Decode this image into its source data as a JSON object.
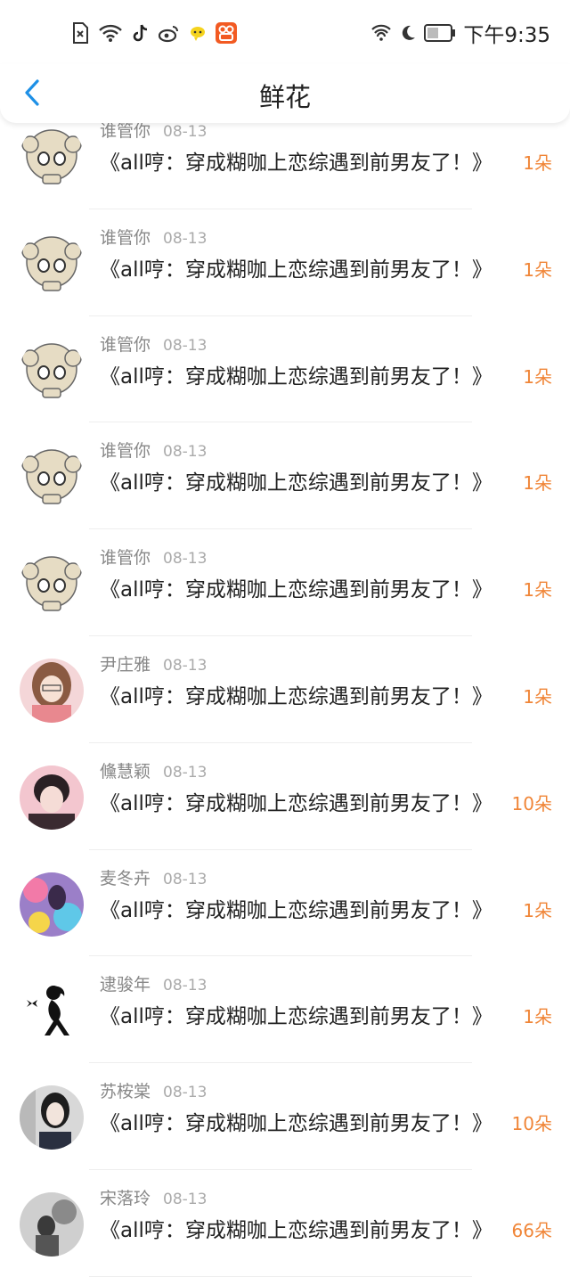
{
  "status_bar": {
    "time": "下午9:35",
    "left_icons": [
      "sim-off-icon",
      "wifi-icon",
      "tiktok-icon",
      "weibo-icon",
      "chat-app-icon",
      "kuaishou-icon"
    ],
    "right_icons": [
      "wifi-signal-icon",
      "moon-icon",
      "battery-icon"
    ]
  },
  "nav": {
    "title": "鲜花",
    "back_icon": "chevron-left-icon",
    "accent_color": "#1e90e6"
  },
  "colors": {
    "count": "#f08537",
    "name": "#888888",
    "date": "#aaaaaa",
    "text": "#222222"
  },
  "items": [
    {
      "user": "谁管你",
      "date": "08-13",
      "book": "《all哼：穿成糊咖上恋综遇到前男友了！》",
      "count": "1朵",
      "avatar": "skull"
    },
    {
      "user": "谁管你",
      "date": "08-13",
      "book": "《all哼：穿成糊咖上恋综遇到前男友了！》",
      "count": "1朵",
      "avatar": "skull"
    },
    {
      "user": "谁管你",
      "date": "08-13",
      "book": "《all哼：穿成糊咖上恋综遇到前男友了！》",
      "count": "1朵",
      "avatar": "skull"
    },
    {
      "user": "谁管你",
      "date": "08-13",
      "book": "《all哼：穿成糊咖上恋综遇到前男友了！》",
      "count": "1朵",
      "avatar": "skull"
    },
    {
      "user": "谁管你",
      "date": "08-13",
      "book": "《all哼：穿成糊咖上恋综遇到前男友了！》",
      "count": "1朵",
      "avatar": "skull"
    },
    {
      "user": "尹庄雅",
      "date": "08-13",
      "book": "《all哼：穿成糊咖上恋综遇到前男友了！》",
      "count": "1朵",
      "avatar": "anime-girl"
    },
    {
      "user": "儵慧颖",
      "date": "08-13",
      "book": "《all哼：穿成糊咖上恋综遇到前男友了！》",
      "count": "10朵",
      "avatar": "pink-girl"
    },
    {
      "user": "麦冬卉",
      "date": "08-13",
      "book": "《all哼：穿成糊咖上恋综遇到前男友了！》",
      "count": "1朵",
      "avatar": "colorful"
    },
    {
      "user": "逮骏年",
      "date": "08-13",
      "book": "《all哼：穿成糊咖上恋综遇到前男友了！》",
      "count": "1朵",
      "avatar": "silhouette"
    },
    {
      "user": "苏桉棠",
      "date": "08-13",
      "book": "《all哼：穿成糊咖上恋综遇到前男友了！》",
      "count": "10朵",
      "avatar": "photo-girl"
    },
    {
      "user": "宋落玲",
      "date": "08-13",
      "book": "《all哼：穿成糊咖上恋综遇到前男友了！》",
      "count": "66朵",
      "avatar": "bw-photo"
    }
  ]
}
